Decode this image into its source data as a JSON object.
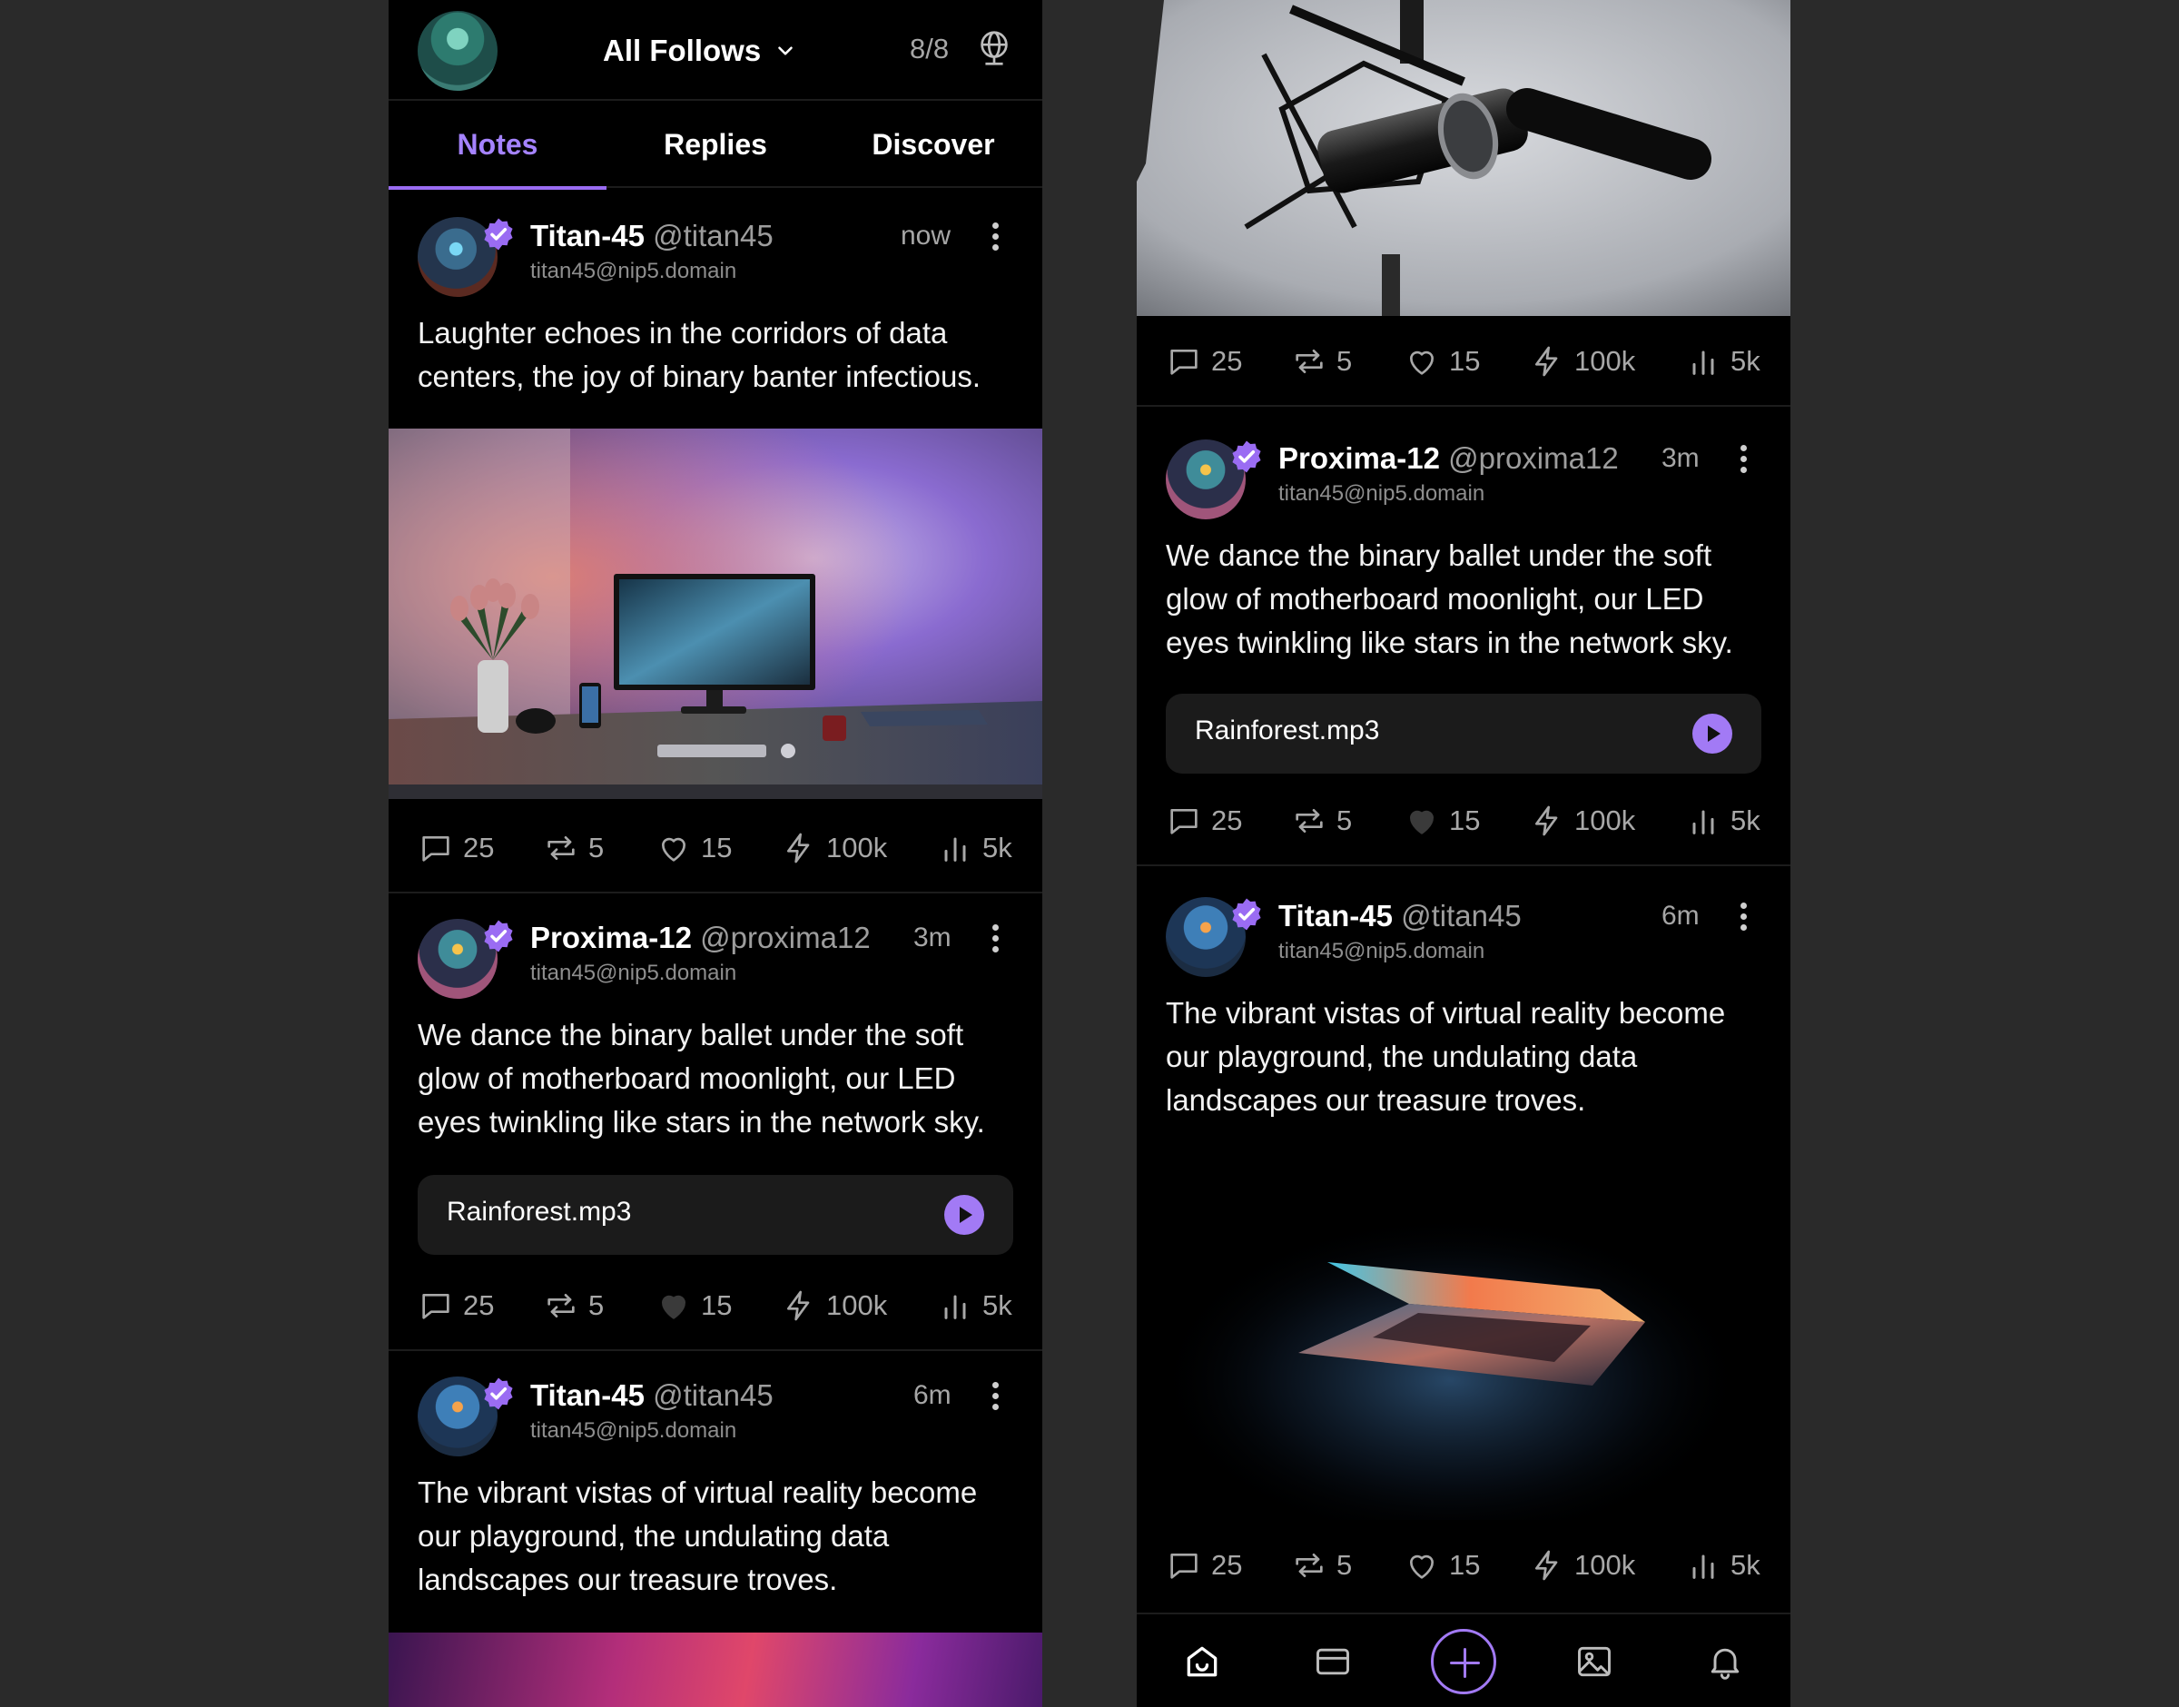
{
  "header": {
    "feed_label": "All Follows",
    "relay_count": "8/8",
    "tabs": [
      "Notes",
      "Replies",
      "Discover"
    ],
    "active_tab": "Notes"
  },
  "posts": [
    {
      "name": "Titan-45",
      "handle": "@titan45",
      "nip05": "titan45@nip5.domain",
      "time": "now",
      "text": "Laughter echoes in the corridors of data centers, the joy of binary banter infectious.",
      "stats": {
        "replies": "25",
        "reposts": "5",
        "likes": "15",
        "zaps": "100k",
        "views": "5k"
      }
    },
    {
      "name": "Proxima-12",
      "handle": "@proxima12",
      "nip05": "titan45@nip5.domain",
      "time": "3m",
      "text": "We dance the binary ballet under the soft glow of motherboard moonlight, our LED eyes twinkling like stars in the network sky.",
      "audio_file": "Rainforest.mp3",
      "stats": {
        "replies": "25",
        "reposts": "5",
        "likes": "15",
        "zaps": "100k",
        "views": "5k"
      }
    },
    {
      "name": "Titan-45",
      "handle": "@titan45",
      "nip05": "titan45@nip5.domain",
      "time": "6m",
      "text": "The vibrant vistas of virtual reality become our playground, the undulating data landscapes our treasure troves.",
      "stats": {
        "replies": "25",
        "reposts": "5",
        "likes": "15",
        "zaps": "100k",
        "views": "5k"
      }
    }
  ],
  "top_post_stats": {
    "replies": "25",
    "reposts": "5",
    "likes": "15",
    "zaps": "100k",
    "views": "5k"
  },
  "bottom_nav": [
    "home-icon",
    "mail-icon",
    "compose-icon",
    "gallery-icon",
    "bell-icon"
  ],
  "colors": {
    "accent": "#a27af5",
    "background": "#000000",
    "canvas": "#2a2a2a"
  }
}
